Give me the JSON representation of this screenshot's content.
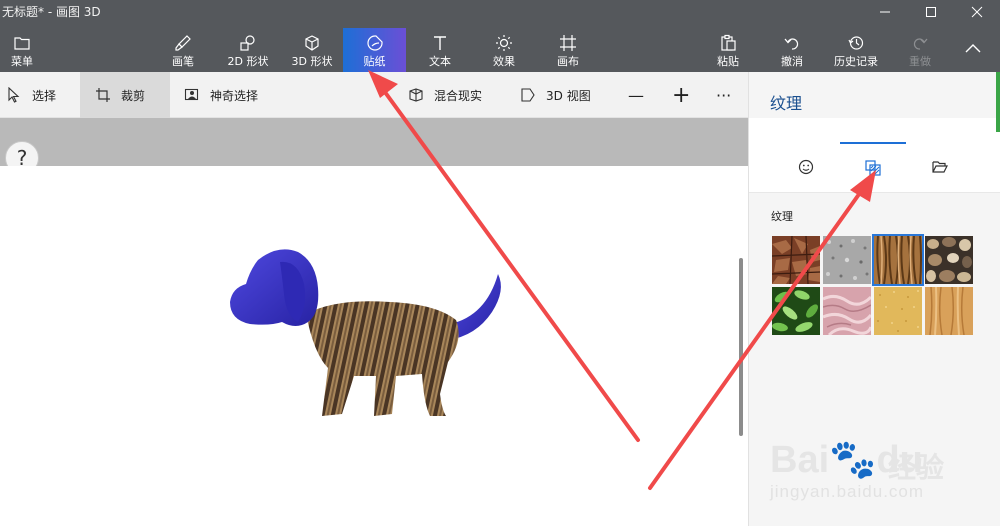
{
  "window": {
    "title": "无标题* - 画图 3D"
  },
  "toolbar": {
    "menu": "菜单",
    "brushes": "画笔",
    "shapes2d": "2D 形状",
    "shapes3d": "3D 形状",
    "stickers": "贴纸",
    "text": "文本",
    "effects": "效果",
    "canvas": "画布",
    "paste": "粘贴",
    "undo": "撤消",
    "history": "历史记录",
    "redo": "重做"
  },
  "subtoolbar": {
    "select": "选择",
    "crop": "裁剪",
    "magic_select": "神奇选择",
    "mixed_reality": "混合现实",
    "view3d": "3D 视图",
    "zoom_out": "—",
    "zoom_in": "+",
    "more": "···"
  },
  "help": "?",
  "panel": {
    "title": "纹理",
    "section_label": "纹理",
    "tabs": [
      "sticker-icon",
      "texture-icon",
      "folder-icon"
    ],
    "active_tab": 1,
    "textures": [
      {
        "name": "bark",
        "selected": false
      },
      {
        "name": "granite",
        "selected": false
      },
      {
        "name": "hair",
        "selected": true
      },
      {
        "name": "pebbles",
        "selected": false
      },
      {
        "name": "leaves",
        "selected": false
      },
      {
        "name": "marble",
        "selected": false
      },
      {
        "name": "sand",
        "selected": false
      },
      {
        "name": "wood",
        "selected": false
      }
    ]
  },
  "watermark": {
    "main": "Bai",
    "du": "du",
    "cn": "经验",
    "sub": "jingyan.baidu.com"
  },
  "colors": {
    "toolbar_bg": "#55585c",
    "active_tool": "#1d6fd6",
    "panel_title": "#1a4f8f",
    "arrow": "#f04a4a",
    "dog_head": "#3a34c9"
  }
}
